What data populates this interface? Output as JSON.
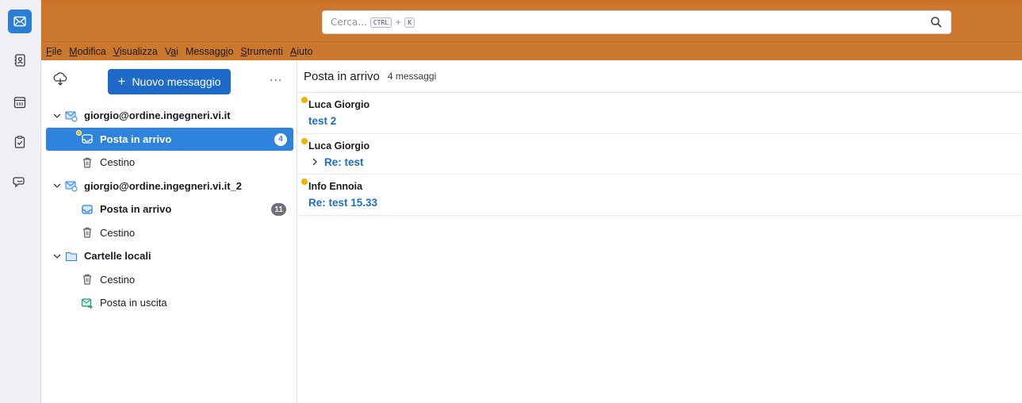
{
  "search": {
    "placeholder": "Cerca...",
    "shortcut_key1": "CTRL",
    "shortcut_plus": "+",
    "shortcut_key2": "K"
  },
  "menubar": [
    {
      "label": "File",
      "underline": "F",
      "rest": "ile"
    },
    {
      "label": "Modifica",
      "underline": "M",
      "rest": "odifica"
    },
    {
      "label": "Visualizza",
      "underline": "V",
      "rest": "isualizza"
    },
    {
      "label": "Vai",
      "pre": "V",
      "underline": "a",
      "rest": "i"
    },
    {
      "label": "Messaggio",
      "pre": "Messagg",
      "underline": "i",
      "rest": "o"
    },
    {
      "label": "Strumenti",
      "underline": "S",
      "rest": "trumenti"
    },
    {
      "label": "Aiuto",
      "underline": "A",
      "rest": "iuto"
    }
  ],
  "folderpane": {
    "new_message_plus": "+",
    "new_message_label": "Nuovo messaggio",
    "more": "...",
    "account1": {
      "name": "giorgio@ordine.ingegneri.vi.it",
      "inbox": "Posta in arrivo",
      "inbox_count": "4",
      "trash": "Cestino"
    },
    "account2": {
      "name": "giorgio@ordine.ingegneri.vi.it_2",
      "inbox": "Posta in arrivo",
      "inbox_count": "11",
      "trash": "Cestino"
    },
    "local": {
      "name": "Cartelle locali",
      "trash": "Cestino",
      "outbox": "Posta in uscita"
    }
  },
  "threadpane": {
    "title": "Posta in arrivo",
    "count": "4 messaggi",
    "messages": [
      {
        "sender": "Luca Giorgio",
        "subject": "test 2"
      },
      {
        "sender": "Luca Giorgio",
        "subject": "Re: test"
      },
      {
        "sender": "Info Ennoia",
        "subject": "Re: test 15.33"
      }
    ]
  },
  "colors": {
    "accent": "#cb772e",
    "selected": "#2e84dc",
    "link": "#1a6fc6",
    "new_dot": "#f0b400"
  }
}
